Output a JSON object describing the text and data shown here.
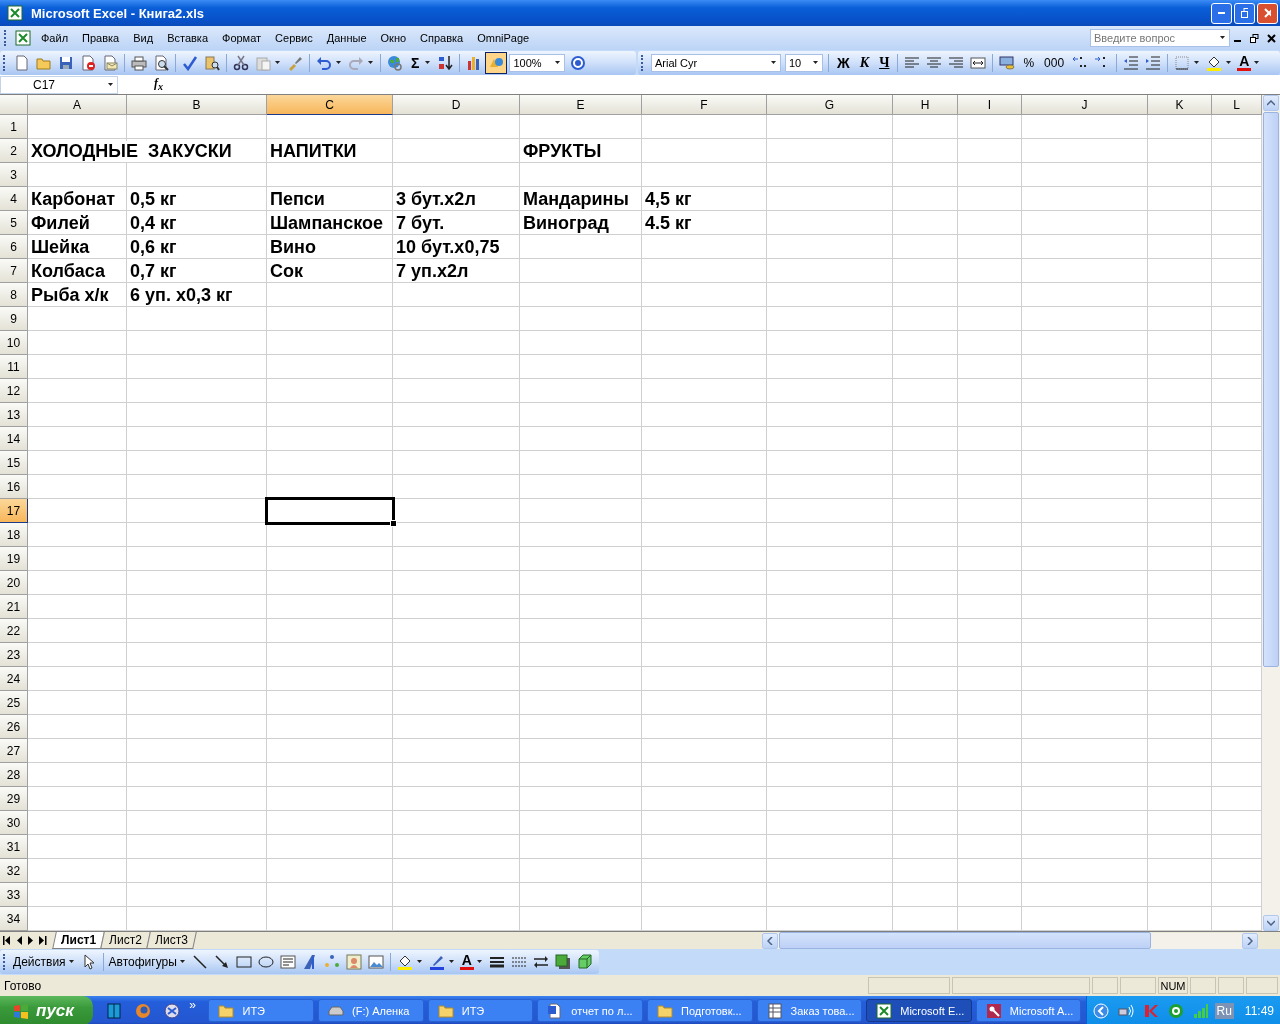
{
  "window": {
    "title": "Microsoft Excel - Книга2.xls"
  },
  "menu_bar": {
    "items": [
      "Файл",
      "Правка",
      "Вид",
      "Вставка",
      "Формат",
      "Сервис",
      "Данные",
      "Окно",
      "Справка",
      "OmniPage"
    ],
    "help_search": {
      "placeholder": "Введите вопрос"
    }
  },
  "standard_toolbar": {
    "autosum": "Σ",
    "zoom": "100%",
    "drawing_pressed": true
  },
  "formatting_toolbar": {
    "font": "Arial Cyr",
    "size": "10",
    "bold": "Ж",
    "italic": "К",
    "underline": "Ч",
    "percent": "%",
    "thousands": "000",
    "font_color": "A"
  },
  "formula_bar": {
    "name_box": "C17",
    "function_label": "f$_{x}$"
  },
  "sheet": {
    "columns": [
      {
        "label": "A",
        "selected": false
      },
      {
        "label": "B",
        "selected": false
      },
      {
        "label": "C",
        "selected": true
      },
      {
        "label": "D",
        "selected": false
      },
      {
        "label": "E",
        "selected": false
      },
      {
        "label": "F",
        "selected": false
      },
      {
        "label": "G",
        "selected": false
      },
      {
        "label": "H",
        "selected": false
      },
      {
        "label": "I",
        "selected": false
      },
      {
        "label": "J",
        "selected": false
      },
      {
        "label": "K",
        "selected": false
      },
      {
        "label": "L",
        "selected": false
      }
    ],
    "rows": [
      {
        "label": "1",
        "selected": false
      },
      {
        "label": "2",
        "selected": false,
        "cells": [
          "ХОЛОДНЫЕ  ЗАКУСКИ",
          null,
          "НАПИТКИ",
          null,
          "ФРУКТЫ"
        ]
      },
      {
        "label": "3",
        "selected": false
      },
      {
        "label": "4",
        "selected": false,
        "cells": [
          "Карбонат",
          "0,5 кг",
          "Пепси",
          "3 бут.x2л",
          "Мандарины",
          "4,5 кг"
        ]
      },
      {
        "label": "5",
        "selected": false,
        "cells": [
          "Филей",
          "0,4 кг",
          "Шампанское",
          "7 бут.",
          "Виноград",
          "4.5 кг"
        ]
      },
      {
        "label": "6",
        "selected": false,
        "cells": [
          "Шейка",
          "0,6 кг",
          "Вино",
          "10 бут.x0,75"
        ]
      },
      {
        "label": "7",
        "selected": false,
        "cells": [
          "Колбаса",
          "0,7 кг",
          "Сок",
          "7 уп.x2л"
        ]
      },
      {
        "label": "8",
        "selected": false,
        "cells": [
          "Рыба х/к",
          "6 уп. x0,3 кг"
        ]
      },
      {
        "label": "9",
        "selected": false
      },
      {
        "label": "10",
        "selected": false
      },
      {
        "label": "11",
        "selected": false
      },
      {
        "label": "12",
        "selected": false
      },
      {
        "label": "13",
        "selected": false
      },
      {
        "label": "14",
        "selected": false
      },
      {
        "label": "15",
        "selected": false
      },
      {
        "label": "16",
        "selected": false
      },
      {
        "label": "17",
        "selected": true
      },
      {
        "label": "18",
        "selected": false
      },
      {
        "label": "19",
        "selected": false
      },
      {
        "label": "20",
        "selected": false
      },
      {
        "label": "21",
        "selected": false
      },
      {
        "label": "22",
        "selected": false
      },
      {
        "label": "23",
        "selected": false
      },
      {
        "label": "24",
        "selected": false
      },
      {
        "label": "25",
        "selected": false
      },
      {
        "label": "26",
        "selected": false
      },
      {
        "label": "27",
        "selected": false
      },
      {
        "label": "28",
        "selected": false
      },
      {
        "label": "29",
        "selected": false
      },
      {
        "label": "30",
        "selected": false
      },
      {
        "label": "31",
        "selected": false
      },
      {
        "label": "32",
        "selected": false
      },
      {
        "label": "33",
        "selected": false
      },
      {
        "label": "34",
        "selected": false
      }
    ]
  },
  "sheet_tabs": [
    {
      "label": "Лист1",
      "selected": true
    },
    {
      "label": "Лист2",
      "selected": false
    },
    {
      "label": "Лист3",
      "selected": false
    }
  ],
  "drawing_toolbar": {
    "actions": "Действия",
    "autoshapes": "Автофигуры",
    "font_color": "A"
  },
  "status_bar": {
    "status": "Готово",
    "num_lock": "NUM"
  },
  "taskbar": {
    "start": "пуск",
    "more": "»",
    "tasks": [
      {
        "label": "ИТЭ",
        "kind": "folder",
        "selected": false
      },
      {
        "label": "(F:) Аленка",
        "kind": "drive",
        "selected": false
      },
      {
        "label": "ИТЭ",
        "kind": "folder",
        "selected": false
      },
      {
        "label": "отчет по л...",
        "kind": "word",
        "selected": false
      },
      {
        "label": "Подготовк...",
        "kind": "folder",
        "selected": false
      },
      {
        "label": "Заказ това...",
        "kind": "table",
        "selected": false
      },
      {
        "label": "Microsoft E...",
        "kind": "excel",
        "selected": true
      },
      {
        "label": "Microsoft A...",
        "kind": "access",
        "selected": false
      }
    ],
    "tray": {
      "language": "Ru",
      "clock": "11:49"
    }
  }
}
